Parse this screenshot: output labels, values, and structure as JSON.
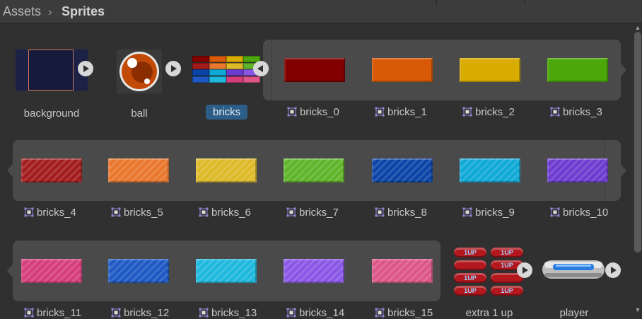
{
  "breadcrumb": {
    "root": "Assets",
    "separator": "›",
    "current": "Sprites"
  },
  "assets": {
    "background": {
      "label": "background"
    },
    "ball": {
      "label": "ball"
    },
    "bricks": {
      "label": "bricks"
    },
    "extra_1_up": {
      "label": "extra 1 up",
      "tag_text": "1UP"
    },
    "player": {
      "label": "player"
    }
  },
  "sub_sprites": [
    {
      "label": "bricks_0",
      "color": "#820000"
    },
    {
      "label": "bricks_1",
      "color": "#d95a06"
    },
    {
      "label": "bricks_2",
      "color": "#d9ad00"
    },
    {
      "label": "bricks_3",
      "color": "#4ca80a"
    },
    {
      "label": "bricks_4",
      "color": "#a31c1c"
    },
    {
      "label": "bricks_5",
      "color": "#e9772c"
    },
    {
      "label": "bricks_6",
      "color": "#deb928"
    },
    {
      "label": "bricks_7",
      "color": "#5fb42a"
    },
    {
      "label": "bricks_8",
      "color": "#0a44a6"
    },
    {
      "label": "bricks_9",
      "color": "#0fa9d6"
    },
    {
      "label": "bricks_10",
      "color": "#6c3bd0"
    },
    {
      "label": "bricks_11",
      "color": "#d63d7c"
    },
    {
      "label": "bricks_12",
      "color": "#1d58c4"
    },
    {
      "label": "bricks_13",
      "color": "#1db8dd"
    },
    {
      "label": "bricks_14",
      "color": "#8a56e6"
    },
    {
      "label": "bricks_15",
      "color": "#dc5688"
    }
  ]
}
